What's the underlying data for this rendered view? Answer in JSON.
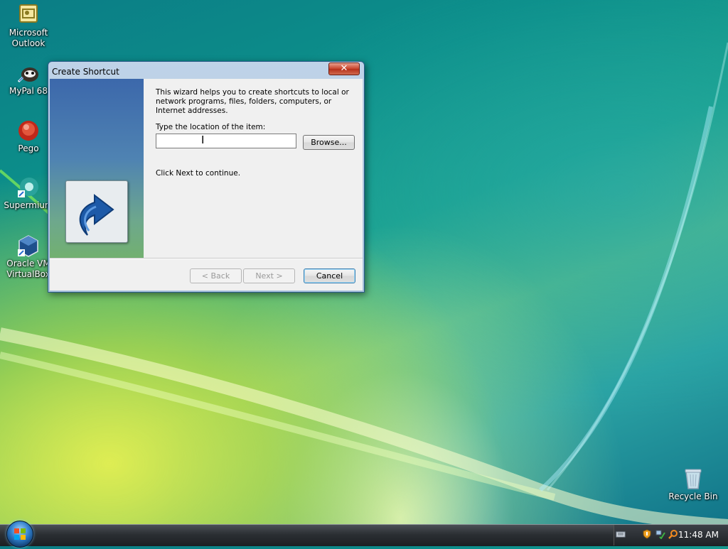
{
  "desktop": {
    "icons": [
      {
        "label_line1": "Microsoft",
        "label_line2": "Outlook"
      },
      {
        "label_line1": "MyPal 68",
        "label_line2": ""
      },
      {
        "label_line1": "Pego",
        "label_line2": ""
      },
      {
        "label_line1": "Supermium",
        "label_line2": ""
      },
      {
        "label_line1": "Oracle VM",
        "label_line2": "VirtualBox"
      },
      {
        "label_line1": "Recycle Bin",
        "label_line2": ""
      }
    ]
  },
  "dialog": {
    "title": "Create Shortcut",
    "close_symbol": "✕",
    "intro_text": "This wizard helps you to create shortcuts to local or network programs, files, folders, computers, or Internet addresses.",
    "location_label": "Type the location of the item:",
    "location_value": "",
    "browse_label": "Browse...",
    "continue_text": "Click Next to continue.",
    "back_label": "< Back",
    "next_label": "Next >",
    "cancel_label": "Cancel"
  },
  "taskbar": {
    "clock": "11:48 AM"
  },
  "colors": {
    "accent": "#2a5b8a",
    "close_red": "#c7422a"
  }
}
